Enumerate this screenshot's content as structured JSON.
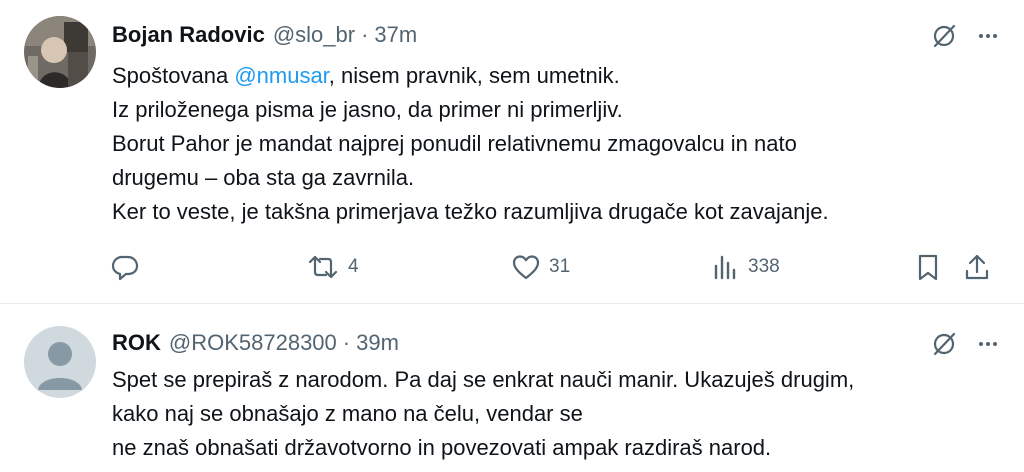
{
  "tweets": [
    {
      "author_name": "Bojan Radovic",
      "handle": "@slo_br",
      "separator": "·",
      "time": "37m",
      "text": {
        "line1_before": "Spoštovana ",
        "line1_mention": "@nmusar",
        "line1_after": ", nisem pravnik, sem umetnik.",
        "line2": "Iz priloženega pisma je jasno, da primer ni primerljiv.",
        "line3": "Borut Pahor je mandat najprej ponudil relativnemu zmagovalcu in nato",
        "line4": "drugemu – oba sta ga zavrnila.",
        "line5": "Ker to veste, je takšna primerjava težko razumljiva drugače kot zavajanje."
      },
      "stats": {
        "retweets": "4",
        "likes": "31",
        "views": "338"
      },
      "more_label": "···"
    },
    {
      "author_name": "ROK",
      "handle": "@ROK58728300",
      "separator": "·",
      "time": "39m",
      "text": {
        "line1": "Spet se prepiraš z narodom. Pa  daj se enkrat nauči manir. Ukazuješ drugim,",
        "line2": "kako naj se obnašajo z mano na čelu, vendar se",
        "line3": "ne znaš obnašati državotvorno in povezovati ampak razdiraš narod."
      },
      "more_label": "···"
    }
  ],
  "icons": {
    "translate": "grok-slash-icon",
    "reply": "reply-icon",
    "retweet": "retweet-icon",
    "like": "heart-icon",
    "views": "views-chart-icon",
    "bookmark": "bookmark-icon",
    "share": "share-icon"
  },
  "colors": {
    "text": "#0f1419",
    "secondary": "#536471",
    "link": "#1d9bf0",
    "border": "#e6ecf0"
  }
}
